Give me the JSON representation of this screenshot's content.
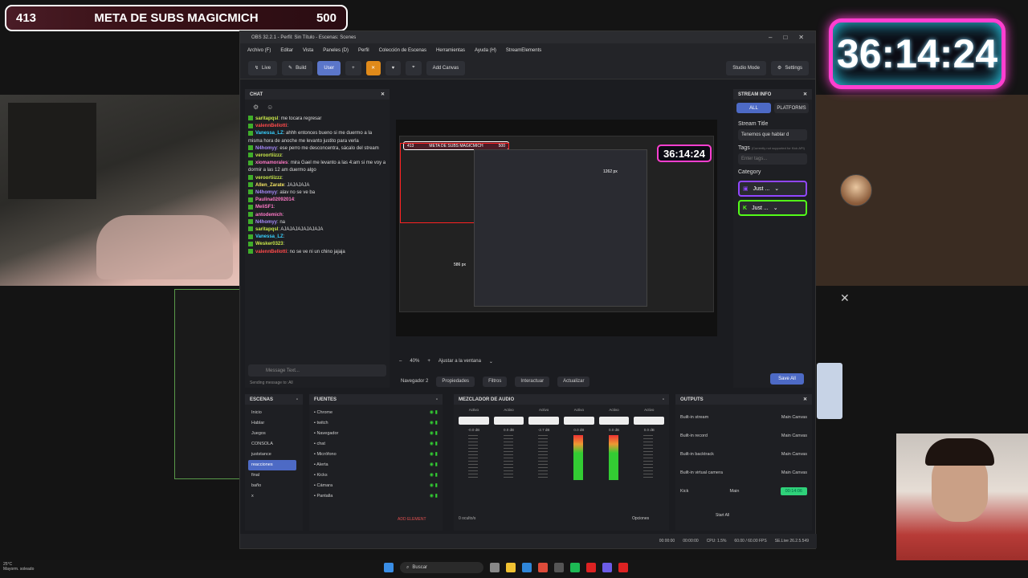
{
  "overlay": {
    "goal": {
      "current": "413",
      "title": "META DE SUBS MAGICMICH",
      "target": "500"
    },
    "timer": "36:14:24"
  },
  "obs": {
    "title": "OBS 32.2.1 - Perfil: Sin Título - Escenas: Scenes",
    "menu": [
      "Archivo (F)",
      "Editar",
      "Vista",
      "Paneles (D)",
      "Perfil",
      "Colección de Escenas",
      "Herramientas",
      "Ayuda (H)",
      "StreamElements"
    ],
    "toolbar": {
      "live": "Live",
      "build": "Build",
      "user": "User",
      "add_canvas": "Add Canvas",
      "studio_mode": "Studio Mode",
      "settings": "Settings"
    },
    "chat": {
      "title": "CHAT",
      "messages": [
        {
          "user": "saritapqsl",
          "text": ": me tocara regresar",
          "color": "#c9e84a"
        },
        {
          "user": "valennBellotti",
          "text": ":",
          "color": "#ff4b4b"
        },
        {
          "user": "Vanessa_LZ",
          "text": ": ahhh entonces bueno si me duermo a la misma hora de anoche me levanto justito para verla",
          "color": "#38d1ff"
        },
        {
          "user": "N4homyy",
          "text": ": ese perro me desconcentra, sácalo del stream",
          "color": "#a78bfa"
        },
        {
          "user": "veroortiizzz",
          "text": ":",
          "color": "#c9e84a"
        },
        {
          "user": "xiomamorales",
          "text": ": mira Gael me levanto a las 4:am si me voy a dormir a las 12 am duermo algo",
          "color": "#ff79c6"
        },
        {
          "user": "veroortiizzz",
          "text": ":",
          "color": "#c9e84a"
        },
        {
          "user": "Allen_Zarate",
          "text": ": JAJAJAJA",
          "color": "#f5e663"
        },
        {
          "user": "N4homyy",
          "text": ": alav no se ve ba",
          "color": "#a78bfa"
        },
        {
          "user": "Paulina02092014",
          "text": ":",
          "color": "#ff79c6"
        },
        {
          "user": "MeliSF1",
          "text": ":",
          "color": "#ff79c6"
        },
        {
          "user": "antodemich",
          "text": ":",
          "color": "#ff79c6"
        },
        {
          "user": "N4homyy",
          "text": ": na",
          "color": "#a78bfa"
        },
        {
          "user": "saritapqsl",
          "text": ": AJAJAJAJAJAJAJA",
          "color": "#c9e84a"
        },
        {
          "user": "Vanessa_LZ",
          "text": ":",
          "color": "#38d1ff"
        },
        {
          "user": "Wesker0323",
          "text": ":",
          "color": "#c9e84a"
        },
        {
          "user": "valennBellotti",
          "text": ": no se ve ni un chino jajaja",
          "color": "#ff4b4b"
        }
      ],
      "message_placeholder": "Message Text...",
      "sending_to": "Sending message to: All"
    },
    "preview": {
      "selection_w": "1262 px",
      "selection_h": "586 px"
    },
    "zoom": {
      "level": "40%",
      "fit": "Ajustar a la ventana"
    },
    "source_bar": {
      "name": "Navegador 2",
      "properties": "Propiedades",
      "filters": "Filtros",
      "interact": "Interactuar",
      "refresh": "Actualizar"
    },
    "stream_info": {
      "title": "STREAM INFO",
      "tabs": [
        "ALL",
        "PLATFORMS"
      ],
      "stream_title_label": "Stream Title",
      "stream_title_value": "Tenemos que hablar d",
      "tags_label": "Tags",
      "tags_note": "(Currently not supported for Kick API)",
      "tags_placeholder": "Enter tags...",
      "category_label": "Category",
      "category_twitch": "Just ...",
      "category_kick": "Just ...",
      "save_all": "Save All"
    },
    "scenes": {
      "title": "ESCENAS",
      "items": [
        "Inicio",
        "Hablar",
        "Juegos",
        "CONSOLA",
        "juststance",
        "reacciones",
        "final",
        "baño",
        "x"
      ],
      "selected": 5
    },
    "sources": {
      "title": "FUENTES",
      "items": [
        "Chrome",
        "twitch",
        "Navegador",
        "chat",
        "Micrófono",
        "Alerta",
        "Kicks",
        "Cámara",
        "Pantalla"
      ],
      "add_element": "ADD ELEMENT"
    },
    "mixer": {
      "title": "MEZCLADOR DE AUDIO",
      "channels": [
        {
          "status": "Activo",
          "db": "-0.0 dB"
        },
        {
          "status": "Activo",
          "db": "0.0 dB"
        },
        {
          "status": "Activo",
          "db": "-2.7 dB"
        },
        {
          "status": "Activo",
          "db": "0.0 dB"
        },
        {
          "status": "Activo",
          "db": "0.0 dB"
        },
        {
          "status": "Activo",
          "db": "0.0 dB"
        }
      ],
      "hidden": "0 oculto/s",
      "options": "Opciones"
    },
    "outputs": {
      "title": "OUTPUTS",
      "rows": [
        {
          "name": "Built-in stream",
          "canvas": "Main Canvas"
        },
        {
          "name": "Built-in record",
          "canvas": "Main Canvas"
        },
        {
          "name": "Built-in backtrack",
          "canvas": "Main Canvas"
        },
        {
          "name": "Built-in virtual camera",
          "canvas": "Main Canvas"
        },
        {
          "name": "Kick",
          "canvas": "Main",
          "live": "00:14:06"
        }
      ],
      "start_all": "Start All"
    },
    "status": {
      "t1": "00:00:00",
      "t2": "00:00:00",
      "cpu": "CPU: 1.5%",
      "fps": "60.00 / 60.00 FPS",
      "se": "SE.Live 26.2.5.549"
    }
  },
  "taskbar": {
    "weather_temp": "25°C",
    "weather_text": "Mayorm. soleado",
    "search": "Buscar"
  }
}
